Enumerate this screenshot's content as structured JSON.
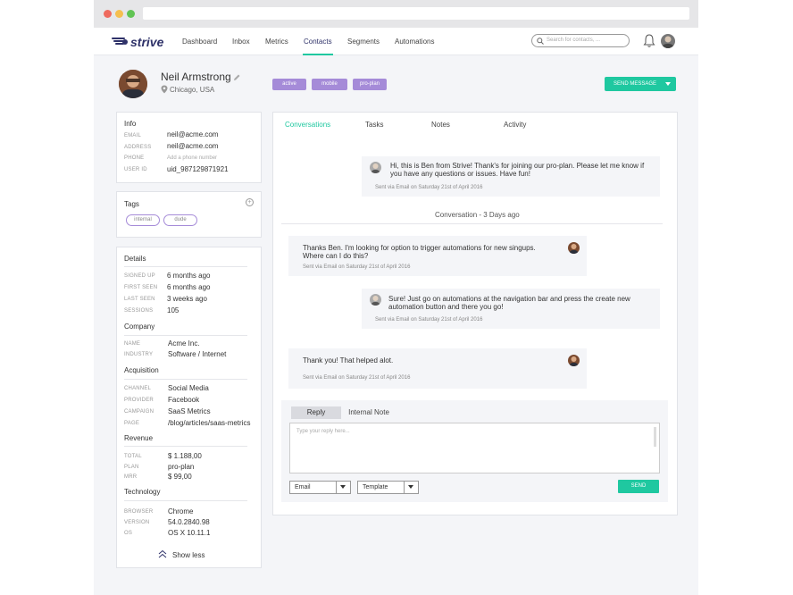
{
  "nav": {
    "logo": "strive",
    "links": [
      {
        "label": "Dashboard"
      },
      {
        "label": "Inbox"
      },
      {
        "label": "Metrics"
      },
      {
        "label": "Contacts"
      },
      {
        "label": "Segments"
      },
      {
        "label": "Automations"
      }
    ],
    "active": "Contacts",
    "search_placeholder": "Search for contacts, ..."
  },
  "profile": {
    "name": "Neil Armstrong",
    "location": "Chicago, USA",
    "tags": [
      "active",
      "mobile",
      "pro-plan"
    ],
    "send_message": "SEND MESSAGE"
  },
  "info": {
    "title": "Info",
    "rows": [
      {
        "k": "EMAIL",
        "v": "neil@acme.com"
      },
      {
        "k": "ADDRESS",
        "v": "neil@acme.com"
      },
      {
        "k": "PHONE",
        "v": "Add a phone number"
      },
      {
        "k": "USER ID",
        "v": "uid_987129871921"
      }
    ]
  },
  "tags_card": {
    "title": "Tags",
    "items": [
      "internal",
      "dude"
    ]
  },
  "details": {
    "title": "Details",
    "rows": [
      {
        "k": "SIGNED UP",
        "v": "6 months ago"
      },
      {
        "k": "FIRST SEEN",
        "v": "6 months ago"
      },
      {
        "k": "LAST SEEN",
        "v": "3 weeks ago"
      },
      {
        "k": "SESSIONS",
        "v": "105"
      }
    ],
    "company_title": "Company",
    "company": [
      {
        "k": "NAME",
        "v": "Acme Inc."
      },
      {
        "k": "INDUSTRY",
        "v": "Software / Internet"
      }
    ],
    "acq_title": "Acquisition",
    "acquisition": [
      {
        "k": "CHANNEL",
        "v": "Social Media"
      },
      {
        "k": "PROVIDER",
        "v": "Facebook"
      },
      {
        "k": "CAMPAIGN",
        "v": "SaaS Metrics"
      },
      {
        "k": "PAGE",
        "v": "/blog/articles/saas-metrics"
      }
    ],
    "rev_title": "Revenue",
    "revenue": [
      {
        "k": "TOTAL",
        "v": "$ 1.188,00"
      },
      {
        "k": "PLAN",
        "v": "pro-plan"
      },
      {
        "k": "MRR",
        "v": "$ 99,00"
      }
    ],
    "tech_title": "Technology",
    "technology": [
      {
        "k": "BROWSER",
        "v": "Chrome"
      },
      {
        "k": "VERSION",
        "v": "54.0.2840.98"
      },
      {
        "k": "OS",
        "v": "OS X 10.11.1"
      }
    ],
    "show_less": "Show less"
  },
  "tabs": [
    "Conversations",
    "Tasks",
    "Notes",
    "Activity"
  ],
  "conversation": {
    "divider": "Conversation - 3 Days ago",
    "messages": [
      {
        "text1": "Hi, this is Ben from Strive! Thank's for joining our pro-plan. Please let me know if",
        "text2": "you have any questions or issues. Have fun!",
        "meta": "Sent via Email on Saturday 21st of April 2016"
      },
      {
        "text1": "Thanks Ben. I'm looking for option to trigger automations for new singups.",
        "text2": "Where can I do this?",
        "meta": "Sent via Email on Saturday 21st of April 2016"
      },
      {
        "text1": "Sure! Just go on automations at the navigation bar and press the create new",
        "text2": "automation button and there you go!",
        "meta": "Sent via Email on Saturday 21st of April 2016"
      },
      {
        "text1": "Thank you! That helped alot.",
        "text2": "",
        "meta": "Sent via Email on Saturday 21st of April 2016"
      }
    ]
  },
  "reply": {
    "tab_reply": "Reply",
    "tab_note": "Internal Note",
    "placeholder": "Type your reply here...",
    "channel": "Email",
    "template": "Template",
    "send": "SEND"
  },
  "colors": {
    "accent": "#1fc8a0",
    "tag": "#a58bd8",
    "brand": "#2f3269"
  }
}
